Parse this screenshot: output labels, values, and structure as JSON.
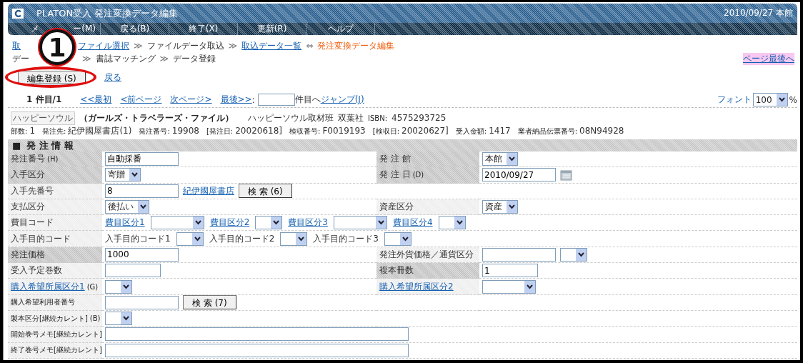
{
  "window": {
    "title": "PLATON受入 発注変換データ編集",
    "status": "2010/09/27 本館"
  },
  "menu": [
    {
      "label": "メ",
      "label_tail": "ー(M)"
    },
    {
      "label": "戻る(B)"
    },
    {
      "label": "終了(X)"
    },
    {
      "label": "更新(R)"
    },
    {
      "label": "ヘルプ"
    }
  ],
  "breadcrumb": [
    {
      "kind": "link",
      "text": "取"
    },
    {
      "kind": "link",
      "text": "ファイル選択"
    },
    {
      "kind": "sep",
      "text": "≫"
    },
    {
      "kind": "text",
      "text": "ファイルデータ取込"
    },
    {
      "kind": "sep",
      "text": "≫"
    },
    {
      "kind": "link",
      "text": "取込データ一覧"
    },
    {
      "kind": "sep",
      "text": "⇔"
    },
    {
      "kind": "current",
      "text": "発注変換データ編集"
    }
  ],
  "breadcrumb_2": [
    {
      "kind": "text",
      "text": "デー"
    },
    {
      "kind": "sep",
      "text": "≫"
    },
    {
      "kind": "text",
      "text": "書誌マッチング"
    },
    {
      "kind": "sep",
      "text": "≫"
    },
    {
      "kind": "text",
      "text": "データ登録"
    }
  ],
  "page_end_link": "ページ最後へ",
  "actions": {
    "save_button": "編集登録 (S)",
    "back_link": "戻る"
  },
  "callout": {
    "number": "1"
  },
  "pager": {
    "position": "1 件目/1",
    "links": [
      "<<最初",
      "<前ページ",
      "次ページ>",
      "最後>>"
    ],
    "colon": ":",
    "suffix": "件目へ",
    "jump_link": "ジャンプ(J)",
    "font_label": "フォント",
    "font_value": "100",
    "percent": "%"
  },
  "book": {
    "title_tag": "ハッピーソウル",
    "subtitle": "（ガールズ・トラベラーズ・ファイル）",
    "author": "ハッピーソウル取材班",
    "publisher": "双葉社",
    "isbn_label": "ISBN:",
    "isbn": "4575293725"
  },
  "order_info": [
    {
      "label": "部数:",
      "value": "1"
    },
    {
      "label": "発注先:",
      "value": "紀伊國屋書店(1)"
    },
    {
      "label": "発注番号:",
      "value": "19908"
    },
    {
      "label": "[発注日:",
      "value": "20020618]"
    },
    {
      "label": "検収番号:",
      "value": "F0019193"
    },
    {
      "label": "[検収日:",
      "value": "20020627]"
    },
    {
      "label": "受入金額:",
      "value": "1417"
    },
    {
      "label": "業者納品伝票番号:",
      "value": "08N94928"
    }
  ],
  "section": {
    "mark": "■",
    "title": "発 注 情 報"
  },
  "rows": [
    {
      "label": {
        "kind": "text",
        "text": "発注番号",
        "hint": "(H)",
        "highlighted": true
      },
      "value": [
        {
          "kind": "input",
          "value": "自動採番"
        }
      ],
      "right": {
        "label": {
          "kind": "text",
          "text": "発 注 館",
          "highlighted": true
        },
        "value": [
          {
            "kind": "select",
            "value": "本館"
          }
        ]
      }
    },
    {
      "label": {
        "kind": "text",
        "text": "入手区分",
        "highlighted": true
      },
      "value": [
        {
          "kind": "select",
          "value": "寄贈"
        }
      ],
      "right": {
        "label": {
          "kind": "text",
          "text": "発 注 日",
          "hint": "(D)",
          "highlighted": true
        },
        "value": [
          {
            "kind": "input",
            "value": "2010/09/27"
          },
          {
            "kind": "calendar"
          }
        ]
      }
    },
    {
      "label": {
        "kind": "text",
        "text": "入手先番号",
        "highlighted": false
      },
      "value": [
        {
          "kind": "input",
          "value": "8"
        },
        {
          "kind": "link",
          "text": "紀伊國屋書店"
        },
        {
          "kind": "button",
          "text": "検 索 (6)"
        }
      ]
    },
    {
      "label": {
        "kind": "text",
        "text": "支払区分",
        "highlighted": false
      },
      "value": [
        {
          "kind": "select",
          "value": "後払い"
        }
      ],
      "right": {
        "label": {
          "kind": "text",
          "text": "資産区分",
          "highlighted": false
        },
        "value": [
          {
            "kind": "select",
            "value": "資産"
          }
        ]
      }
    },
    {
      "span": true,
      "label": {
        "kind": "text",
        "text": "費目コード",
        "highlighted": false
      },
      "value": [
        {
          "kind": "link",
          "text": "費目区分1"
        },
        {
          "kind": "wide-select"
        },
        {
          "kind": "link",
          "text": "費目区分2"
        },
        {
          "kind": "select"
        },
        {
          "kind": "link",
          "text": "費目区分3"
        },
        {
          "kind": "wide-select"
        },
        {
          "kind": "link",
          "text": "費目区分4"
        },
        {
          "kind": "select"
        }
      ]
    },
    {
      "span": true,
      "label": {
        "kind": "text",
        "text": "入手目的コード",
        "highlighted": false
      },
      "value": [
        {
          "kind": "text",
          "text": "入手目的コード1"
        },
        {
          "kind": "select"
        },
        {
          "kind": "text",
          "text": "入手目的コード2"
        },
        {
          "kind": "select"
        },
        {
          "kind": "text",
          "text": "入手目的コード3"
        },
        {
          "kind": "select"
        }
      ]
    },
    {
      "label": {
        "kind": "text",
        "text": "発注価格",
        "highlighted": true
      },
      "value": [
        {
          "kind": "input",
          "value": "1000"
        }
      ],
      "right": {
        "label": {
          "kind": "text",
          "text": "発注外貨価格／通貨区分",
          "highlighted": false
        },
        "value": [
          {
            "kind": "input"
          },
          {
            "kind": "select"
          }
        ]
      }
    },
    {
      "label": {
        "kind": "text",
        "text": "受入予定巻数",
        "highlighted": false
      },
      "value": [
        {
          "kind": "short-input"
        }
      ],
      "right": {
        "label": {
          "kind": "text",
          "text": "複本冊数",
          "highlighted": true
        },
        "value": [
          {
            "kind": "short-input",
            "value": "1"
          }
        ]
      }
    },
    {
      "label": {
        "kind": "link",
        "text": "購入希望所属区分1",
        "hint": "(G)",
        "highlighted": false
      },
      "value": [
        {
          "kind": "select"
        }
      ],
      "right": {
        "label": {
          "kind": "link",
          "text": "購入希望所属区分2",
          "highlighted": false
        },
        "value": [
          {
            "kind": "wide-select"
          }
        ]
      }
    },
    {
      "label": {
        "kind": "note",
        "text": "購入希望利用者番号",
        "highlighted": false
      },
      "value": [
        {
          "kind": "input"
        },
        {
          "kind": "button",
          "text": "検 索 (7)"
        }
      ]
    },
    {
      "label": {
        "kind": "note",
        "text": "製本区分[継続カレント]",
        "hint": "(B)",
        "highlighted": false
      },
      "value": [
        {
          "kind": "select"
        }
      ]
    },
    {
      "span": true,
      "label": {
        "kind": "note",
        "text": "開始巻号メモ[継続カレント]",
        "highlighted": false
      },
      "value": [
        {
          "kind": "memo"
        }
      ]
    },
    {
      "span": true,
      "label": {
        "kind": "note",
        "text": "終了巻号メモ[継続カレント]",
        "highlighted": false
      },
      "value": [
        {
          "kind": "memo"
        }
      ]
    }
  ]
}
